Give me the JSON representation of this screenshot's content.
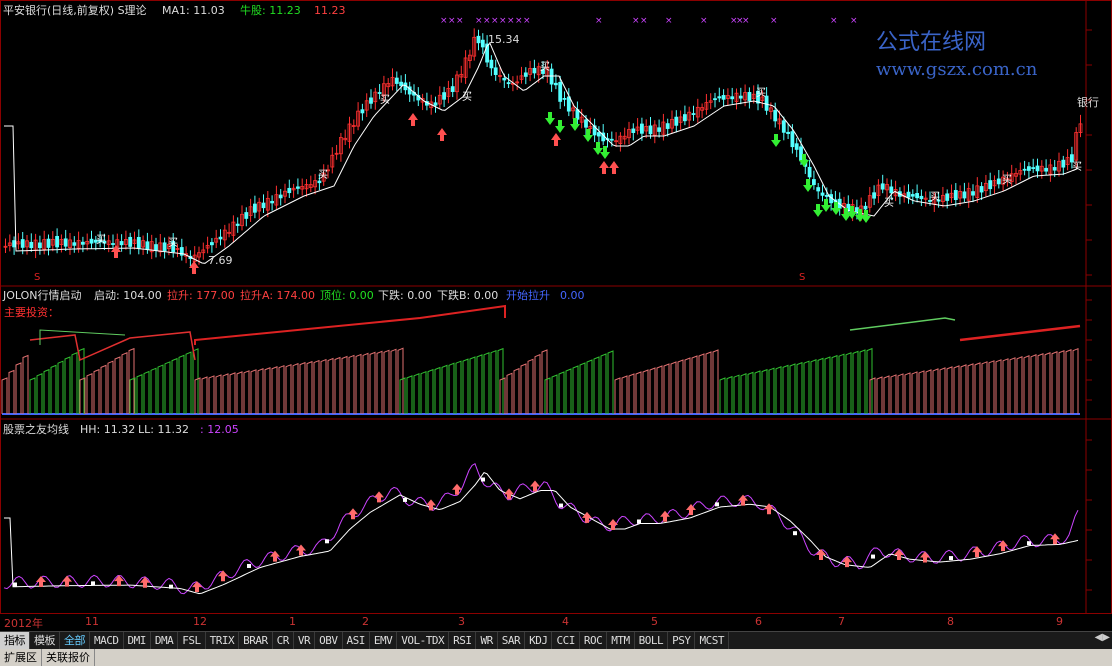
{
  "panel1": {
    "title": "平安银行(日线,前复权) S理论",
    "ma_label": "MA1: 11.03",
    "niu_label": "牛股: 11.23",
    "niu_value2": "11.23",
    "high_label": "15.34",
    "low_label": "7.69",
    "right_label": "银行",
    "buy_mark": "买",
    "s_mark": "S"
  },
  "panel2": {
    "title": "JOLON行情启动",
    "qidong": "启动: 104.00",
    "lasheng": "拉升: 177.00",
    "lashengA": "拉升A: 174.00",
    "dingwei": "顶位: 0.00",
    "xiadie": "下跌: 0.00",
    "xiadieB": "下跌B: 0.00",
    "kaishi": "开始拉升",
    "kaishi_val": "0.00",
    "zhuli": "主要投资："
  },
  "panel3": {
    "title": "股票之友均线",
    "hh": "HH: 11.32",
    "ll": "LL: 11.32",
    "val": ": 12.05"
  },
  "watermark": {
    "cn": "公式在线网",
    "url": "www.gszx.com.cn"
  },
  "xaxis": {
    "labels": [
      "2012年",
      "11",
      "12",
      "1",
      "2",
      "3",
      "4",
      "5",
      "6",
      "7",
      "8",
      "9"
    ]
  },
  "tabs": [
    "指标",
    "模板",
    "全部",
    "MACD",
    "DMI",
    "DMA",
    "FSL",
    "TRIX",
    "BRAR",
    "CR",
    "VR",
    "OBV",
    "ASI",
    "EMV",
    "VOL-TDX",
    "RSI",
    "WR",
    "SAR",
    "KDJ",
    "CCI",
    "ROC",
    "MTM",
    "BOLL",
    "PSY",
    "MCST"
  ],
  "bottom_tabs": [
    "扩展区",
    "关联报价"
  ],
  "colors": {
    "up": "#ff3030",
    "down": "#54ffff",
    "ma": "#ffffff",
    "buy_arrow": "#ff5050",
    "sell_arrow": "#22dd22",
    "purple": "#cc44ff",
    "green": "#22cc22",
    "red": "#dd2222",
    "blue": "#4466ff"
  }
}
